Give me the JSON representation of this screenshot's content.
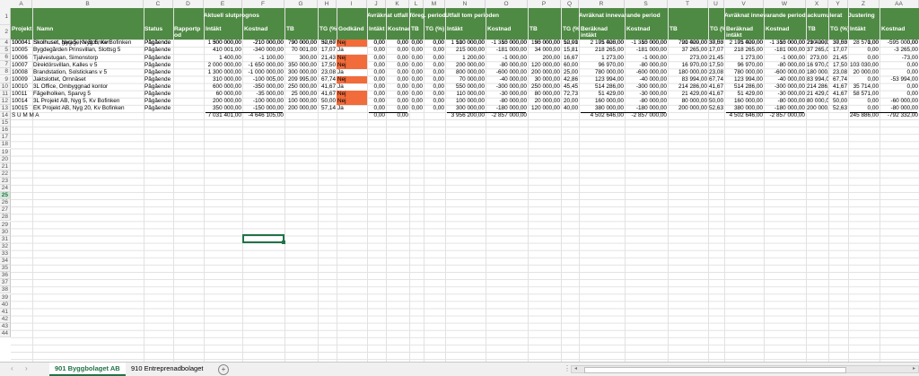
{
  "columns": [
    "A",
    "B",
    "C",
    "D",
    "E",
    "F",
    "G",
    "H",
    "I",
    "J",
    "K",
    "L",
    "M",
    "N",
    "O",
    "P",
    "Q",
    "R",
    "S",
    "T",
    "U",
    "V",
    "W",
    "X",
    "Y",
    "Z",
    "AA"
  ],
  "row_numbers": [
    "1",
    "2",
    "3",
    "4",
    "5",
    "6",
    "7",
    "8",
    "9",
    "10",
    "11",
    "12",
    "13",
    "14",
    "15",
    "16",
    "17",
    "18",
    "19",
    "20",
    "21",
    "22",
    "23",
    "24",
    "25",
    "26",
    "27",
    "28",
    "29",
    "30",
    "31",
    "32",
    "33",
    "34",
    "35",
    "36",
    "37",
    "38",
    "39",
    "40",
    "41",
    "42",
    "43",
    "44"
  ],
  "selected_row": "25",
  "groups": {
    "aktuell": "Aktuell slutprognos",
    "foreg": "Avräknat utfall föreg. period (",
    "utfall": "Utfall tom perioden",
    "innev": "Avräknat innevarande period",
    "ack": "Avräknat innevarande period ackumulerat",
    "just": "Justering"
  },
  "headers": {
    "projekt": "Projekt",
    "namn": "Namn",
    "status": "Status",
    "rapport": "Rapportp od",
    "intakt": "Intäkt",
    "kostnad": "Kostnad",
    "tb": "TB",
    "tg": "TG (%)",
    "godkand": "Godkänd",
    "beraknad": "Beräknad intäkt"
  },
  "rows": [
    {
      "projekt": "10004",
      "namn": "Skolhuset, Nyg 5, Kv Bofinken",
      "status": "Pågående",
      "e": "1 500 000,00",
      "f": "-710 000,00",
      "g": "790 000,00",
      "h": "52,67",
      "i": "Nej",
      "j": "0,00",
      "k": "0,00",
      "l": "0,00",
      "m": "0,00",
      "n": "1 510 000,00",
      "o": "-1 315 000,00",
      "p": "195 000,00",
      "q": "12,91",
      "r": "2 105 000,00",
      "s": "-1 315 000,00",
      "t": "790 000,00",
      "u": "37,53",
      "v": "2 105 000,00",
      "w": "-1 315 000,00",
      "x": "790 000,00",
      "y": "37,53",
      "z": "0,00",
      "aa": "-595 000,00"
    },
    {
      "projekt": "100041",
      "namn": "Skolhuset, garage, Nyg 5, Kv Bofinken",
      "status": "Pågående",
      "e": "300 000,00",
      "f": "-210 000,00",
      "g": "90 000,00",
      "h": "30,00",
      "i": "Nej",
      "j": "0,00",
      "k": "0,00",
      "l": "0,00",
      "m": "0,00",
      "n": "100 000,00",
      "o": "-50 000,00",
      "p": "50 000,00",
      "q": "50,00",
      "r": "71 428,00",
      "s": "-50 000,00",
      "t": "21 429,00",
      "u": "30,00",
      "v": "71 429,00",
      "w": "-50 000,00",
      "x": "21 429,00",
      "y": "30,00",
      "z": "28 571,00",
      "aa": "0,00"
    },
    {
      "projekt": "10005",
      "namn": "Bygdegården Prinsvillan, Slottsg 5",
      "status": "Pågående",
      "e": "410 001,00",
      "f": "-340 000,00",
      "g": "70 001,00",
      "h": "17,07",
      "i": "Ja",
      "j": "0,00",
      "k": "0,00",
      "l": "0,00",
      "m": "0,00",
      "n": "215 000,00",
      "o": "-181 000,00",
      "p": "34 000,00",
      "q": "15,81",
      "r": "218 265,00",
      "s": "-181 000,00",
      "t": "37 265,00",
      "u": "17,07",
      "v": "218 265,00",
      "w": "-181 000,00",
      "x": "37 265,00",
      "y": "17,07",
      "z": "0,00",
      "aa": "-3 265,00"
    },
    {
      "projekt": "10006",
      "namn": "Tjalvestugan, Simonstorp",
      "status": "Pågående",
      "e": "1 400,00",
      "f": "-1 100,00",
      "g": "300,00",
      "h": "21,43",
      "i": "Nej",
      "j": "0,00",
      "k": "0,00",
      "l": "0,00",
      "m": "0,00",
      "n": "1 200,00",
      "o": "-1 000,00",
      "p": "200,00",
      "q": "16,67",
      "r": "1 273,00",
      "s": "-1 000,00",
      "t": "273,00",
      "u": "21,45",
      "v": "1 273,00",
      "w": "-1 000,00",
      "x": "273,00",
      "y": "21,45",
      "z": "0,00",
      "aa": "-73,00"
    },
    {
      "projekt": "10007",
      "namn": "Direktörsvillan, Kalles v 5",
      "status": "Pågående",
      "e": "2 000 000,00",
      "f": "-1 650 000,00",
      "g": "350 000,00",
      "h": "17,50",
      "i": "Nej",
      "j": "0,00",
      "k": "0,00",
      "l": "0,00",
      "m": "0,00",
      "n": "200 000,00",
      "o": "-80 000,00",
      "p": "120 000,00",
      "q": "60,00",
      "r": "96 970,00",
      "s": "-80 000,00",
      "t": "16 970,00",
      "u": "17,50",
      "v": "96 970,00",
      "w": "-80 000,00",
      "x": "16 970,00",
      "y": "17,50",
      "z": "103 030,00",
      "aa": "0,00"
    },
    {
      "projekt": "10008",
      "namn": "Brandstation, Solstickans v 5",
      "status": "Pågående",
      "e": "1 300 000,00",
      "f": "-1 000 000,00",
      "g": "300 000,00",
      "h": "23,08",
      "i": "Ja",
      "j": "0,00",
      "k": "0,00",
      "l": "0,00",
      "m": "0,00",
      "n": "800 000,00",
      "o": "-600 000,00",
      "p": "200 000,00",
      "q": "25,00",
      "r": "780 000,00",
      "s": "-600 000,00",
      "t": "180 000,00",
      "u": "23,08",
      "v": "780 000,00",
      "w": "-600 000,00",
      "x": "180 000,00",
      "y": "23,08",
      "z": "20 000,00",
      "aa": "0,00"
    },
    {
      "projekt": "10009",
      "namn": "Jaktslottet, Örnnäset",
      "status": "Pågående",
      "e": "310 000,00",
      "f": "-100 005,00",
      "g": "209 995,00",
      "h": "67,74",
      "i": "Nej",
      "j": "0,00",
      "k": "0,00",
      "l": "0,00",
      "m": "0,00",
      "n": "70 000,00",
      "o": "-40 000,00",
      "p": "30 000,00",
      "q": "42,86",
      "r": "123 994,00",
      "s": "-40 000,00",
      "t": "83 994,00",
      "u": "67,74",
      "v": "123 994,00",
      "w": "-40 000,00",
      "x": "83 994,00",
      "y": "67,74",
      "z": "0,00",
      "aa": "-53 994,00"
    },
    {
      "projekt": "10010",
      "namn": "3L Office, Ombyggnad kontor",
      "status": "Pågående",
      "e": "600 000,00",
      "f": "-350 000,00",
      "g": "250 000,00",
      "h": "41,67",
      "i": "Ja",
      "j": "0,00",
      "k": "0,00",
      "l": "0,00",
      "m": "0,00",
      "n": "550 000,00",
      "o": "-300 000,00",
      "p": "250 000,00",
      "q": "45,45",
      "r": "514 286,00",
      "s": "-300 000,00",
      "t": "214 286,00",
      "u": "41,67",
      "v": "514 286,00",
      "w": "-300 000,00",
      "x": "214 286,00",
      "y": "41,67",
      "z": "35 714,00",
      "aa": "0,00"
    },
    {
      "projekt": "10011",
      "namn": "Fågelholken, Sparvg 5",
      "status": "Pågående",
      "e": "60 000,00",
      "f": "-35 000,00",
      "g": "25 000,00",
      "h": "41,67",
      "i": "Nej",
      "j": "0,00",
      "k": "0,00",
      "l": "0,00",
      "m": "0,00",
      "n": "110 000,00",
      "o": "-30 000,00",
      "p": "80 000,00",
      "q": "72,73",
      "r": "51 429,00",
      "s": "-30 000,00",
      "t": "21 429,00",
      "u": "41,67",
      "v": "51 429,00",
      "w": "-30 000,00",
      "x": "21 429,00",
      "y": "41,67",
      "z": "58 571,00",
      "aa": "0,00"
    },
    {
      "projekt": "10014",
      "namn": "3L Projekt AB, Nyg 5, Kv Bofinken",
      "status": "Pågående",
      "e": "200 000,00",
      "f": "-100 000,00",
      "g": "100 000,00",
      "h": "50,00",
      "i": "Nej",
      "j": "0,00",
      "k": "0,00",
      "l": "0,00",
      "m": "0,00",
      "n": "100 000,00",
      "o": "-80 000,00",
      "p": "20 000,00",
      "q": "20,00",
      "r": "160 000,00",
      "s": "-80 000,00",
      "t": "80 000,00",
      "u": "50,00",
      "v": "160 000,00",
      "w": "-80 000,00",
      "x": "80 000,00",
      "y": "50,00",
      "z": "0,00",
      "aa": "-60 000,00"
    },
    {
      "projekt": "10015",
      "namn": "EK Projekt AB, Nyg 20, Kv Bofinken",
      "status": "Pågående",
      "e": "350 000,00",
      "f": "-150 000,00",
      "g": "200 000,00",
      "h": "57,14",
      "i": "Ja",
      "j": "0,00",
      "k": "0,00",
      "l": "0,00",
      "m": "0,00",
      "n": "300 000,00",
      "o": "-180 000,00",
      "p": "120 000,00",
      "q": "40,00",
      "r": "380 000,00",
      "s": "-180 000,00",
      "t": "200 000,00",
      "u": "52,63",
      "v": "380 000,00",
      "w": "-180 000,00",
      "x": "200 000,00",
      "y": "52,63",
      "z": "0,00",
      "aa": "-80 000,00"
    }
  ],
  "summa": {
    "label": "S U M M A",
    "e": "7 031 401,00",
    "f": "-4 646 105,00",
    "j": "0,00",
    "k": "0,00",
    "n": "3 956 200,00",
    "o": "-2 857 000,00",
    "r": "4 502 646,00",
    "s": "-2 857 000,00",
    "v": "4 502 646,00",
    "w": "-2 857 000,00",
    "z": "245 886,00",
    "aa": "-792 332,00"
  },
  "tabs": {
    "active": "901 Byggbolaget AB",
    "other": "910 Entreprenadbolaget",
    "add": "+",
    "prev": "‹",
    "next": "›",
    "more": "⋮",
    "scroll_left": "◂",
    "scroll_right": "▸"
  },
  "colors": {
    "header_green": "#4e8a43",
    "nej_red": "#f26b3a",
    "accent": "#217346"
  }
}
